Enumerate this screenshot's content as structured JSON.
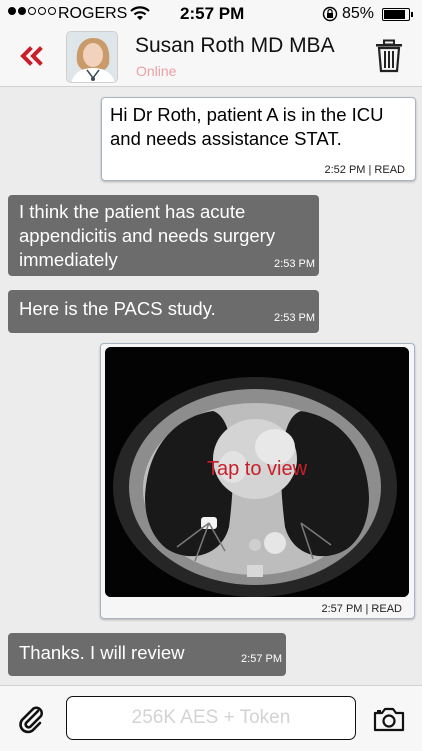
{
  "status_bar": {
    "carrier": "ROGERS",
    "time": "2:57 PM",
    "battery": "85%"
  },
  "header": {
    "back_icon": "double-chevron-left-icon",
    "contact_name": "Susan Roth MD MBA",
    "contact_status": "Online",
    "delete_icon": "trash-icon",
    "accent_color": "#c8202a"
  },
  "messages": [
    {
      "direction": "outgoing",
      "text": "Hi Dr Roth, patient A is in the ICU and needs assistance STAT.",
      "meta": "2:52 PM | READ"
    },
    {
      "direction": "incoming",
      "text": "I think the patient has acute appendicitis and needs surgery immediately",
      "meta": "2:53 PM"
    },
    {
      "direction": "incoming",
      "text": "Here is the PACS study.",
      "meta": "2:53 PM"
    },
    {
      "direction": "outgoing",
      "attachment_overlay": "Tap to view",
      "meta": "2:57 PM | READ"
    },
    {
      "direction": "incoming",
      "text": "Thanks. I will review",
      "meta": "2:57 PM"
    }
  ],
  "composer": {
    "attach_icon": "paperclip-icon",
    "placeholder": "256K AES + Token",
    "camera_icon": "camera-icon"
  }
}
